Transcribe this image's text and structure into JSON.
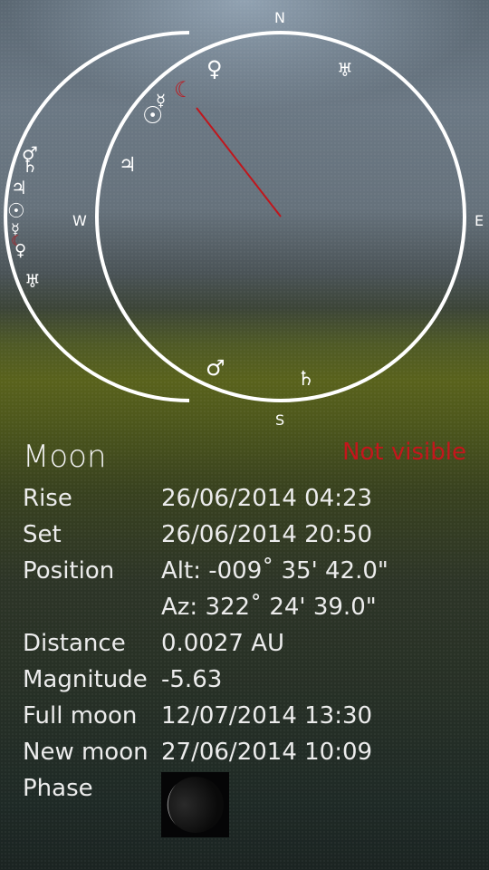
{
  "compass": {
    "north": "N",
    "east": "E",
    "south": "S",
    "west": "W",
    "moon_glyph": "☾",
    "inner_bodies": [
      {
        "name": "venus",
        "glyph": "♀"
      },
      {
        "name": "uranus",
        "glyph": "♅"
      },
      {
        "name": "mercury",
        "glyph": "☿"
      },
      {
        "name": "sun",
        "glyph": "☉"
      },
      {
        "name": "jupiter",
        "glyph": "♃"
      },
      {
        "name": "mars",
        "glyph": "♂"
      },
      {
        "name": "saturn",
        "glyph": "♄"
      }
    ],
    "horizon_bodies": [
      {
        "name": "mars",
        "glyph": "♂"
      },
      {
        "name": "saturn",
        "glyph": "♄"
      },
      {
        "name": "jupiter",
        "glyph": "♃"
      },
      {
        "name": "sun",
        "glyph": "☉"
      },
      {
        "name": "mercury",
        "glyph": "☿"
      },
      {
        "name": "moon",
        "glyph": "☾"
      },
      {
        "name": "venus",
        "glyph": "♀"
      },
      {
        "name": "uranus",
        "glyph": "♅"
      }
    ],
    "colors": {
      "moon": "#c0161c",
      "pointer": "#c0161c",
      "ring": "#ffffff"
    }
  },
  "object": {
    "name": "Moon",
    "visibility": "Not visible",
    "visibility_color": "#c4161c"
  },
  "details": {
    "rise_label": "Rise",
    "rise_value": "26/06/2014 04:23",
    "set_label": "Set",
    "set_value": "26/06/2014 20:50",
    "position_label": "Position",
    "alt_value": "Alt: -009˚ 35' 42.0\"",
    "az_value": "Az:  322˚ 24' 39.0\"",
    "distance_label": "Distance",
    "distance_value": "0.0027 AU",
    "magnitude_label": "Magnitude",
    "magnitude_value": "-5.63",
    "full_moon_label": "Full moon",
    "full_moon_value": "12/07/2014 13:30",
    "new_moon_label": "New moon",
    "new_moon_value": "27/06/2014 10:09",
    "phase_label": "Phase"
  }
}
